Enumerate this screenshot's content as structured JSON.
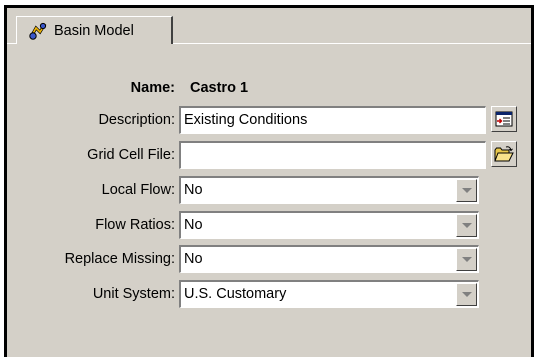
{
  "tab": {
    "label": "Basin Model",
    "icon": "basin-model-icon"
  },
  "form": {
    "name_label": "Name:",
    "name_value": "Castro 1",
    "description": {
      "label": "Description:",
      "value": "Existing Conditions",
      "button_icon": "description-editor-icon"
    },
    "grid_cell_file": {
      "label": "Grid Cell File:",
      "value": "",
      "button_icon": "open-folder-icon"
    },
    "local_flow": {
      "label": "Local Flow:",
      "value": "No"
    },
    "flow_ratios": {
      "label": "Flow Ratios:",
      "value": "No"
    },
    "replace_missing": {
      "label": "Replace Missing:",
      "value": "No"
    },
    "unit_system": {
      "label": "Unit System:",
      "value": "U.S. Customary"
    }
  }
}
